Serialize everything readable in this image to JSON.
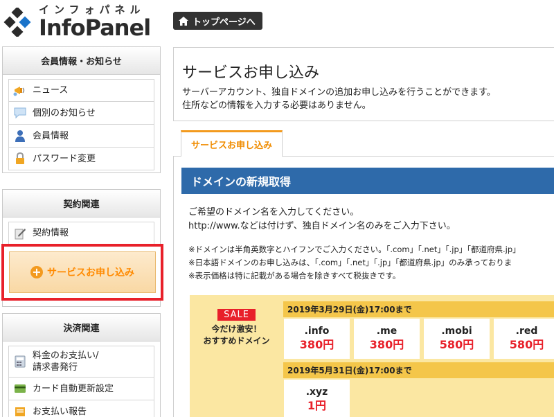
{
  "header": {
    "logo_kana": "インフォパネル",
    "logo_name": "InfoPanel",
    "top_button": "トップページへ"
  },
  "sidebar": {
    "member": {
      "title": "会員情報・お知らせ",
      "items": [
        {
          "label": "ニュース",
          "icon": "megaphone-icon"
        },
        {
          "label": "個別のお知らせ",
          "icon": "speech-bubble-icon"
        },
        {
          "label": "会員情報",
          "icon": "person-icon"
        },
        {
          "label": "パスワード変更",
          "icon": "lock-icon"
        }
      ]
    },
    "contract": {
      "title": "契約関連",
      "items": [
        {
          "label": "契約情報",
          "icon": "document-pen-icon"
        }
      ],
      "apply_button": "サービスお申し込み"
    },
    "payment": {
      "title": "決済関連",
      "items": [
        {
          "label": "料金のお支払い/\n請求書発行",
          "icon": "calculator-icon"
        },
        {
          "label": "カード自動更新設定",
          "icon": "credit-card-icon"
        },
        {
          "label": "お支払い報告",
          "icon": "report-icon"
        }
      ]
    }
  },
  "main": {
    "title": "サービスお申し込み",
    "desc_line1": "サーバーアカウント、独自ドメインの追加お申し込みを行うことができます。",
    "desc_line2": "住所などの情報を入力する必要はありません。",
    "tab": "サービスお申し込み",
    "section_title": "ドメインの新規取得",
    "intro_line1": "ご希望のドメイン名を入力してください。",
    "intro_line2": "http://www.などは付けず、独自ドメイン名のみをご入力下さい。",
    "note1": "※ドメインは半角英数字とハイフンでご入力ください。「.com」「.net」「.jp」「都道府県.jp」",
    "note2": "※日本語ドメインのお申し込みは、「.com」「.net」「.jp」「都道府県.jp」のみ承っておりま",
    "note3": "※表示価格は特に記載がある場合を除きすべて税抜きです。",
    "sale": {
      "badge": "SALE",
      "line1": "今だけ激安！",
      "line2": "おすすめドメイン",
      "group1_date": "2019年3月29日(金)17:00まで",
      "group1": [
        {
          "name": ".info",
          "price": "380円"
        },
        {
          "name": ".me",
          "price": "380円"
        },
        {
          "name": ".mobi",
          "price": "580円"
        },
        {
          "name": ".red",
          "price": "580円"
        }
      ],
      "group2_date": "2019年5月31日(金)17:00まで",
      "group2": [
        {
          "name": ".xyz",
          "price": "1円"
        }
      ]
    }
  },
  "colors": {
    "accent_orange": "#f39a1e",
    "section_blue": "#2e6aaa",
    "price_red": "#e8202a",
    "highlight_red": "#e8202a",
    "sale_bg": "#fbe7a2",
    "date_bar": "#f4c64a"
  }
}
